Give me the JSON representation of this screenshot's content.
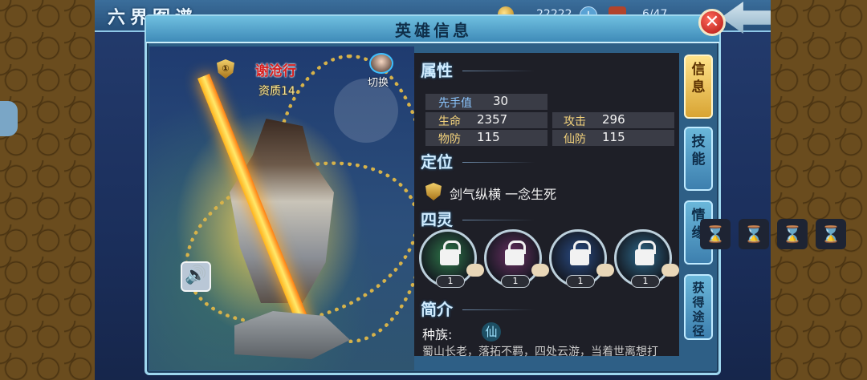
{
  "top_bar": {
    "title": "六界图谱",
    "gold_amount": "22222",
    "plus_label": "+",
    "bag_count": "6/47"
  },
  "panel": {
    "title": "英雄信息",
    "close_label": "✕"
  },
  "hero": {
    "name": "谢沧行",
    "rank_badge": "①",
    "quality": "资质14",
    "switch_label": "切换"
  },
  "attributes": {
    "section_title": "属性",
    "initiative_label": "先手值",
    "initiative_value": "30",
    "hp_label": "生命",
    "hp_value": "2357",
    "attack_label": "攻击",
    "attack_value": "296",
    "pdef_label": "物防",
    "pdef_value": "115",
    "mdef_label": "仙防",
    "mdef_value": "115"
  },
  "role": {
    "section_title": "定位",
    "text": "剑气纵横 一念生死"
  },
  "spirits": {
    "section_title": "四灵",
    "items": [
      {
        "count": "1",
        "color": "#2f7a4a"
      },
      {
        "count": "1",
        "color": "#6a2f62"
      },
      {
        "count": "1",
        "color": "#2a4c86"
      },
      {
        "count": "1",
        "color": "#2e6a8c"
      }
    ]
  },
  "intro": {
    "section_title": "简介",
    "race_label": "种族:",
    "race_value": "仙",
    "bio_text": "蜀山长老，落拓不羁，四处云游，当着世离想打"
  },
  "tabs": [
    {
      "label": "信息",
      "active": true
    },
    {
      "label": "技能",
      "active": false
    },
    {
      "label": "情缘",
      "active": false
    },
    {
      "label": "获得途径",
      "active": false
    }
  ],
  "hourglass_icon": "⌛"
}
